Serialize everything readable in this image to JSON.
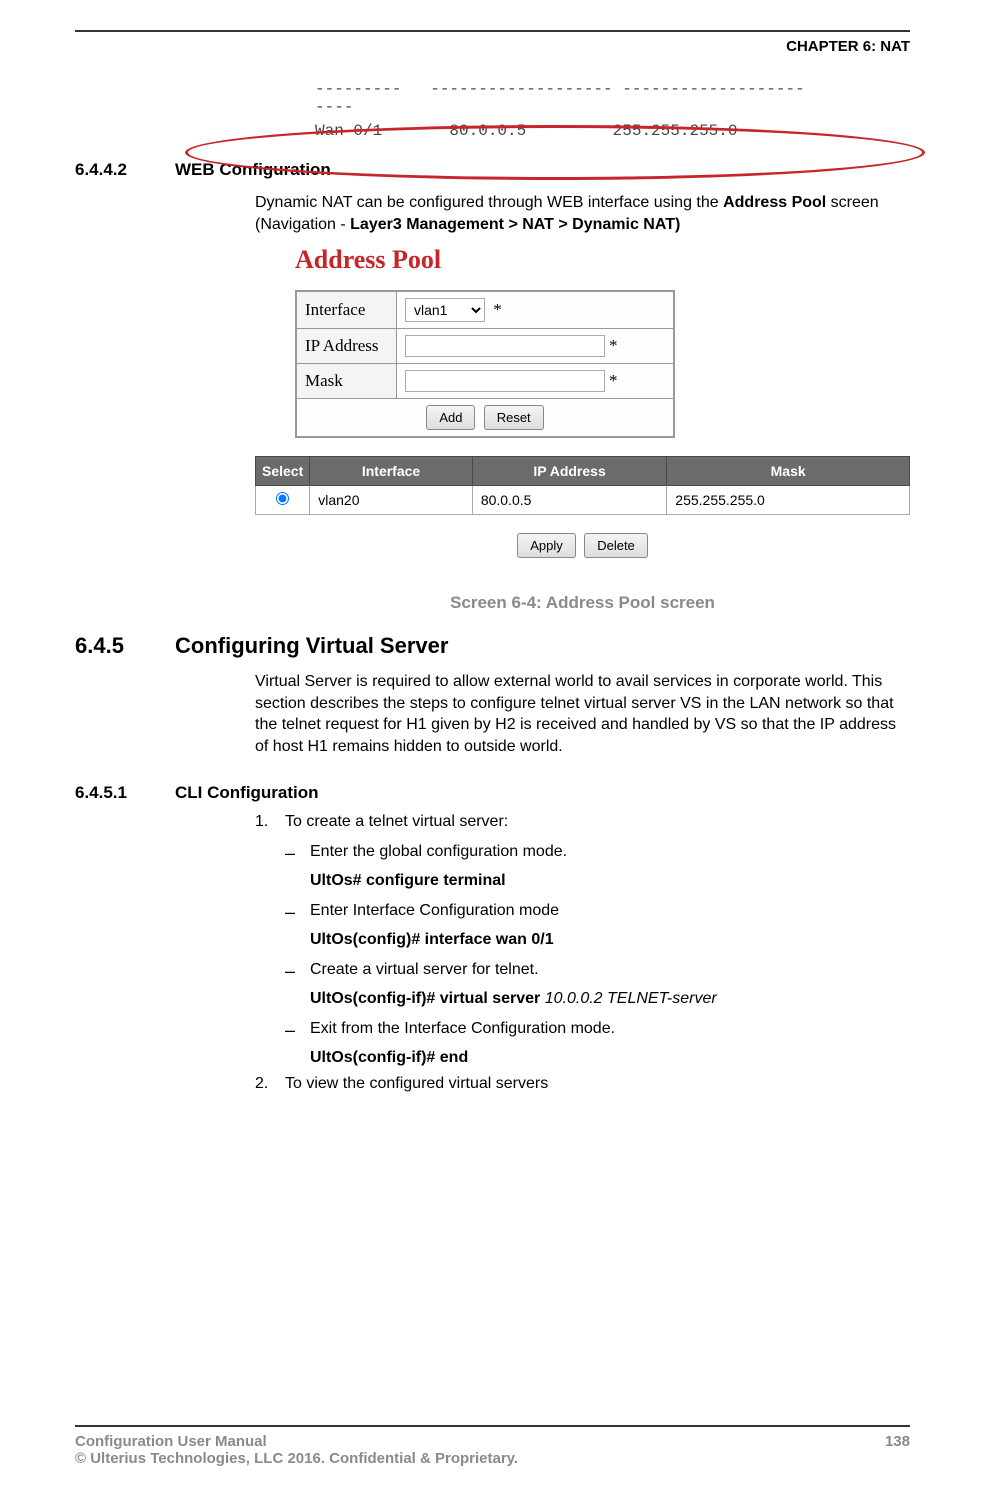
{
  "header": {
    "chapter": "CHAPTER 6: NAT"
  },
  "cli_output": {
    "divider": "---------   ------------------- -------------------\n----",
    "row": "Wan 0/1       80.0.0.5         255.255.255.0"
  },
  "section_6442": {
    "num": "6.4.4.2",
    "title": "WEB Configuration",
    "intro_pre": "Dynamic NAT can be configured through WEB interface using the ",
    "intro_bold1": "Address Pool",
    "intro_mid": " screen (Navigation - ",
    "intro_bold2": "Layer3 Management > NAT > Dynamic NAT)"
  },
  "address_pool": {
    "title": "Address Pool",
    "labels": {
      "interface": "Interface",
      "ip": "IP Address",
      "mask": "Mask"
    },
    "interface_value": "vlan1",
    "buttons": {
      "add": "Add",
      "reset": "Reset",
      "apply": "Apply",
      "delete": "Delete"
    },
    "table": {
      "headers": [
        "Select",
        "Interface",
        "IP Address",
        "Mask"
      ],
      "rows": [
        {
          "selected": true,
          "interface": "vlan20",
          "ip": "80.0.0.5",
          "mask": "255.255.255.0"
        }
      ]
    }
  },
  "caption_64": "Screen 6-4: Address Pool screen",
  "section_645": {
    "num": "6.4.5",
    "title": "Configuring Virtual Server",
    "body": "Virtual Server is required to allow external world to avail services in corporate world. This section describes the steps to configure telnet virtual server VS in the LAN network so that the telnet request for H1 given by H2 is received and handled by VS so that the IP address of host H1 remains hidden to outside world."
  },
  "section_6451": {
    "num": "6.4.5.1",
    "title": "CLI Configuration",
    "steps": [
      {
        "num": "1.",
        "text": "To create a telnet virtual server:",
        "subs": [
          {
            "text": "Enter the global configuration mode.",
            "cmd": "UltOs# configure terminal"
          },
          {
            "text": "Enter Interface Configuration mode",
            "cmd": "UltOs(config)# interface wan 0/1"
          },
          {
            "text": "Create a virtual server for telnet.",
            "cmd": "UltOs(config-if)# virtual server",
            "arg": "10.0.0.2 TELNET-server"
          },
          {
            "text": "Exit from the Interface Configuration mode.",
            "cmd": "UltOs(config-if)# end"
          }
        ]
      },
      {
        "num": "2.",
        "text": "To view the configured virtual servers"
      }
    ]
  },
  "footer": {
    "left1": "Configuration User Manual",
    "left2": "© Ulterius Technologies, LLC 2016. Confidential & Proprietary.",
    "page": "138"
  }
}
